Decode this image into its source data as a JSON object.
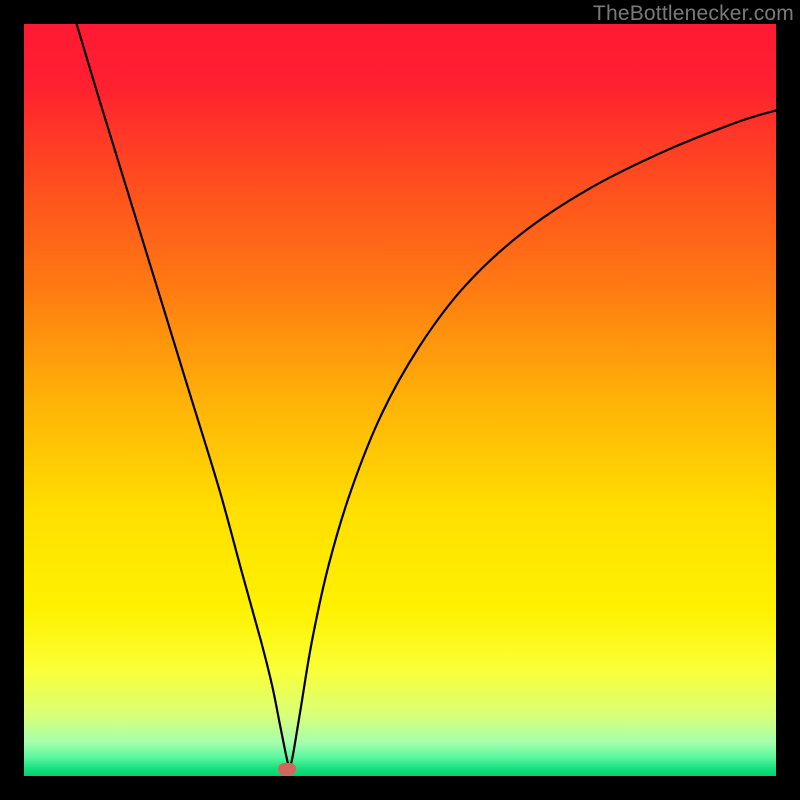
{
  "watermark": "TheBottlenecker.com",
  "chart_data": {
    "type": "line",
    "title": "",
    "xlabel": "",
    "ylabel": "",
    "xlim": [
      0,
      100
    ],
    "ylim": [
      0,
      100
    ],
    "background_gradient": {
      "stops": [
        {
          "pct": 0.0,
          "color": "#ff1a33"
        },
        {
          "pct": 0.08,
          "color": "#ff2030"
        },
        {
          "pct": 0.2,
          "color": "#ff4a20"
        },
        {
          "pct": 0.35,
          "color": "#ff7a12"
        },
        {
          "pct": 0.5,
          "color": "#ffb208"
        },
        {
          "pct": 0.65,
          "color": "#ffe000"
        },
        {
          "pct": 0.78,
          "color": "#fff200"
        },
        {
          "pct": 0.86,
          "color": "#faff38"
        },
        {
          "pct": 0.92,
          "color": "#d8ff7a"
        },
        {
          "pct": 0.955,
          "color": "#a6ffae"
        },
        {
          "pct": 0.975,
          "color": "#5cf7a1"
        },
        {
          "pct": 0.99,
          "color": "#18e07d"
        },
        {
          "pct": 1.0,
          "color": "#00d070"
        }
      ]
    },
    "series": [
      {
        "name": "bottleneck-curve",
        "color": "#000000",
        "x": [
          7,
          10,
          14,
          18,
          22,
          26,
          29,
          31.5,
          33,
          34,
          34.8,
          35.3,
          35.3,
          35.8,
          36.8,
          38.3,
          40.5,
          43.5,
          47.5,
          52.5,
          58.5,
          66,
          75,
          85,
          95,
          100
        ],
        "y": [
          100,
          90,
          77,
          64,
          51,
          38,
          27,
          18,
          12,
          7,
          3,
          0.8,
          0.8,
          3,
          9,
          18,
          28,
          38,
          48,
          57,
          65,
          72,
          78,
          83,
          87,
          88.5
        ]
      }
    ],
    "marker": {
      "name": "optimal-point",
      "x": 35.0,
      "y": 0.9,
      "color": "#d6635c"
    }
  }
}
